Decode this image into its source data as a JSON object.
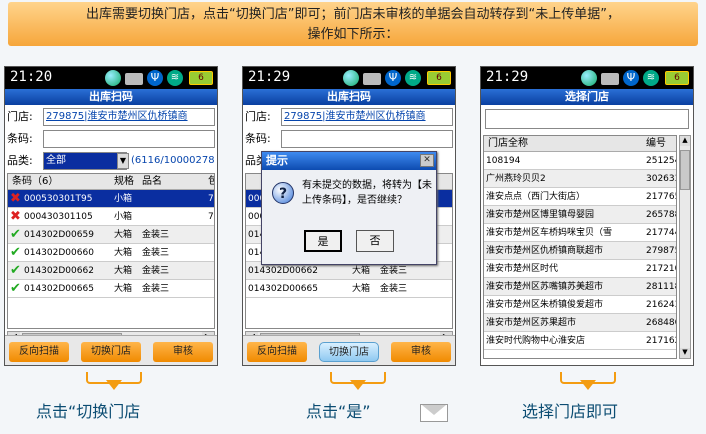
{
  "banner": {
    "line1": "出库需要切换门店，点击“切换门店”即可；前门店未审核的单据会自动转存到“未上传单据”，",
    "line2": "操作如下所示："
  },
  "phone1": {
    "time": "21:20",
    "battery": "6",
    "title": "出库扫码",
    "store_label": "门店:",
    "store_value": "279875|淮安市楚州区仇桥镇商",
    "barcode_label": "条码:",
    "category_label": "品类:",
    "category_value": "全部",
    "category_extra": "(6116/10000278",
    "columns": [
      "条码（6）",
      "规格",
      "品名",
      "包"
    ],
    "rows": [
      {
        "code": "000530301T95",
        "spec": "小箱",
        "name": "",
        "extra": "7",
        "status": "x"
      },
      {
        "code": "000430301105",
        "spec": "小箱",
        "name": "",
        "extra": "7",
        "status": "x"
      },
      {
        "code": "014302D00659",
        "spec": "大箱",
        "name": "金装三",
        "extra": "",
        "status": "ok"
      },
      {
        "code": "014302D00660",
        "spec": "大箱",
        "name": "金装三",
        "extra": "",
        "status": "ok"
      },
      {
        "code": "014302D00662",
        "spec": "大箱",
        "name": "金装三",
        "extra": "",
        "status": "ok"
      },
      {
        "code": "014302D00665",
        "spec": "大箱",
        "name": "金装三",
        "extra": "",
        "status": "ok"
      }
    ],
    "buttons": [
      "反向扫描",
      "切换门店",
      "审核"
    ]
  },
  "phone2": {
    "time": "21:29",
    "battery": "6",
    "title": "出库扫码",
    "store_label": "门店:",
    "store_value": "279875|淮安市楚州区仇桥镇商",
    "barcode_label": "条码:",
    "category_label": "品类:",
    "rows_visible": [
      {
        "code": "000",
        "spec": "",
        "name": ""
      },
      {
        "code": "000",
        "spec": "",
        "name": ""
      },
      {
        "code": "014",
        "spec": "",
        "name": ""
      },
      {
        "code": "014",
        "spec": "",
        "name": ""
      },
      {
        "code": "014302D00662",
        "spec": "大箱",
        "name": "金装三"
      },
      {
        "code": "014302D00665",
        "spec": "大箱",
        "name": "金装三"
      }
    ],
    "dialog": {
      "title": "提示",
      "message": "有未提交的数据，将转为【未上传条码】，是否继续？",
      "yes": "是",
      "no": "否"
    },
    "buttons": [
      "反向扫描",
      "切换门店",
      "审核"
    ]
  },
  "phone3": {
    "time": "21:29",
    "battery": "6",
    "title": "选择门店",
    "columns": [
      "门店全称",
      "编号"
    ],
    "rows": [
      {
        "name": "108194",
        "code": "251254"
      },
      {
        "name": "广州燕玲贝贝2",
        "code": "302633"
      },
      {
        "name": "淮安点点（西门大街店）",
        "code": "217765"
      },
      {
        "name": "淮安市楚州区博里镇母婴园",
        "code": "265788"
      },
      {
        "name": "淮安市楚州区车桥妈咪宝贝（雪",
        "code": "217744"
      },
      {
        "name": "淮安市楚州区仇桥镇商联超市",
        "code": "279875"
      },
      {
        "name": "淮安市楚州区时代",
        "code": "217210"
      },
      {
        "name": "淮安市楚州区苏嘴镇苏美超市",
        "code": "281118"
      },
      {
        "name": "淮安市楚州区朱桥镇俊爱超市",
        "code": "216243"
      },
      {
        "name": "淮安市楚州区苏果超市",
        "code": "268486"
      },
      {
        "name": "淮安时代购物中心淮安店",
        "code": "217162"
      }
    ]
  },
  "captions": {
    "c1": "点击“切换门店",
    "c2": "点击“是”",
    "c3": "选择门店即可"
  },
  "colors": {
    "accent_orange": "#f39c12",
    "title_blue": "#0a3fa0",
    "caption": "#0c4d73"
  }
}
